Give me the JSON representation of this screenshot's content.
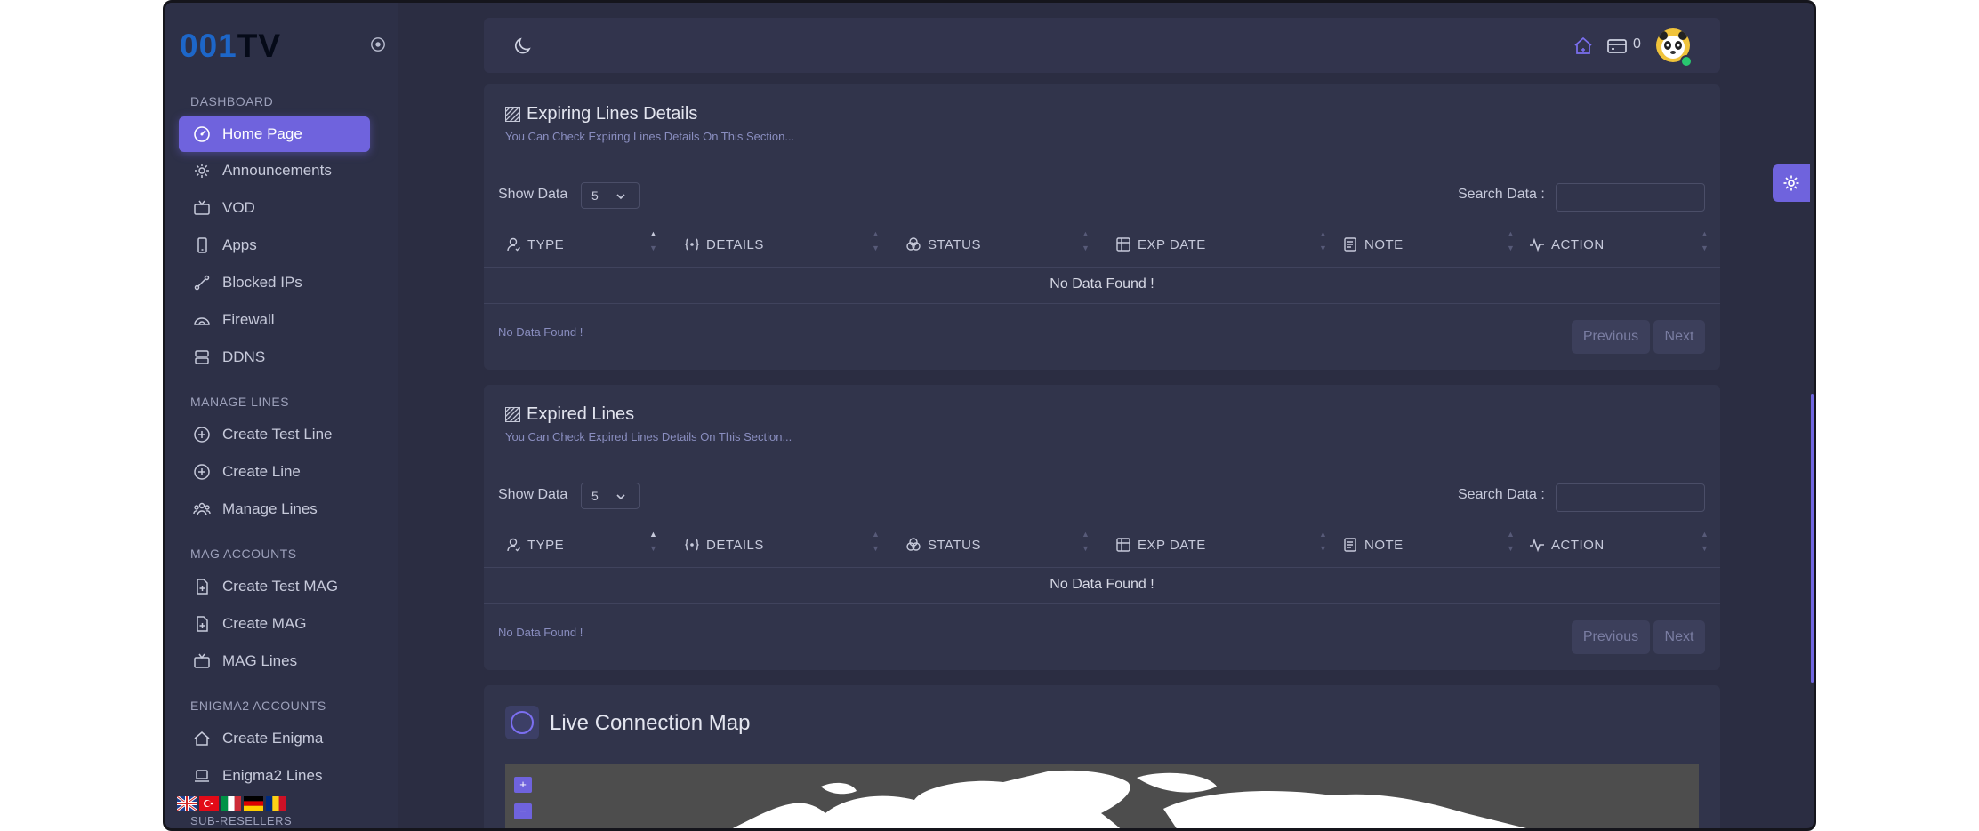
{
  "brand": {
    "logo_part1": "001",
    "logo_part2": "TV"
  },
  "sidebar": {
    "sections": [
      {
        "title": "DASHBOARD"
      },
      {
        "title": "MANAGE LINES"
      },
      {
        "title": "MAG ACCOUNTS"
      },
      {
        "title": "ENIGMA2 ACCOUNTS"
      },
      {
        "title": "SUB-RESELLERS"
      }
    ],
    "items": [
      {
        "label": "Home Page",
        "icon": "dashboard-icon",
        "active": true
      },
      {
        "label": "Announcements",
        "icon": "gear-icon"
      },
      {
        "label": "VOD",
        "icon": "tv-icon"
      },
      {
        "label": "Apps",
        "icon": "mobile-icon"
      },
      {
        "label": "Blocked IPs",
        "icon": "link-icon"
      },
      {
        "label": "Firewall",
        "icon": "cloud-icon"
      },
      {
        "label": "DDNS",
        "icon": "server-icon"
      },
      {
        "label": "Create Test Line",
        "icon": "plus-circle-icon"
      },
      {
        "label": "Create Line",
        "icon": "plus-circle-icon"
      },
      {
        "label": "Manage Lines",
        "icon": "users-icon"
      },
      {
        "label": "Create Test MAG",
        "icon": "file-plus-icon"
      },
      {
        "label": "Create MAG",
        "icon": "file-plus-icon"
      },
      {
        "label": "MAG Lines",
        "icon": "tv-icon"
      },
      {
        "label": "Create Enigma",
        "icon": "home-icon"
      },
      {
        "label": "Enigma2 Lines",
        "icon": "laptop-icon"
      }
    ],
    "languages": [
      "uk-flag-icon",
      "tr-flag-icon",
      "it-flag-icon",
      "de-flag-icon",
      "ro-flag-icon"
    ]
  },
  "topbar": {
    "notification_count": "0"
  },
  "table_columns": [
    "TYPE",
    "DETAILS",
    "STATUS",
    "EXP DATE",
    "NOTE",
    "ACTION"
  ],
  "panels": [
    {
      "title": "Expiring Lines Details",
      "subtitle": "You Can Check Expiring Lines Details On This Section...",
      "show_label": "Show Data",
      "show_value": "5",
      "search_label": "Search Data :",
      "empty_text": "No Data Found !",
      "info_text": "No Data Found !",
      "prev_label": "Previous",
      "next_label": "Next"
    },
    {
      "title": "Expired Lines",
      "subtitle": "You Can Check Expired Lines Details On This Section...",
      "show_label": "Show Data",
      "show_value": "5",
      "search_label": "Search Data :",
      "empty_text": "No Data Found !",
      "info_text": "No Data Found !",
      "prev_label": "Previous",
      "next_label": "Next"
    }
  ],
  "map": {
    "title": "Live Connection Map",
    "zoom_in": "+",
    "zoom_out": "−"
  },
  "colors": {
    "accent": "#6f63dd",
    "sidebar": "#2d3047",
    "panel": "#31344b",
    "background": "#2b2d42",
    "logo": "#1d66c8"
  }
}
